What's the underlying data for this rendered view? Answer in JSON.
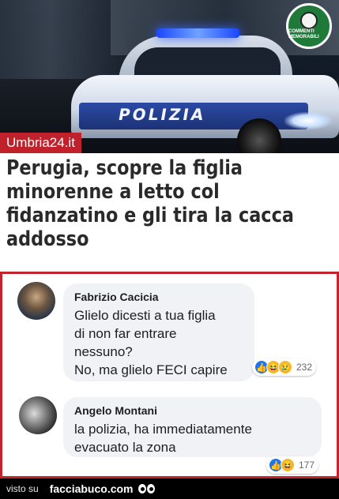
{
  "photo": {
    "car_text": "POLIZIA",
    "source_label": "Umbria24.it",
    "logo_text": "COMMENTI MEMORABILI"
  },
  "headline": "Perugia, scopre la figlia minorenne a letto col fidanzatino e gli tira la cacca addosso",
  "comments": [
    {
      "author": "Fabrizio Cacicia",
      "text": "Glielo dicesti a tua figlia\ndi non far entrare\nnessuno?\nNo, ma glielo FECI capire",
      "reactions": [
        "like",
        "haha",
        "sad"
      ],
      "count": "232"
    },
    {
      "author": "Angelo Montani",
      "text": "la polizia, ha immediatamente\nevacuato la zona",
      "reactions": [
        "like",
        "haha"
      ],
      "count": "177"
    }
  ],
  "footer": {
    "visto_su": "visto su",
    "site": "facciabuco.com"
  },
  "colors": {
    "brand_red": "#c3232c",
    "bubble_bg": "#f0f2f5",
    "like_blue": "#1877f2",
    "emoji_yellow": "#f7b928"
  }
}
